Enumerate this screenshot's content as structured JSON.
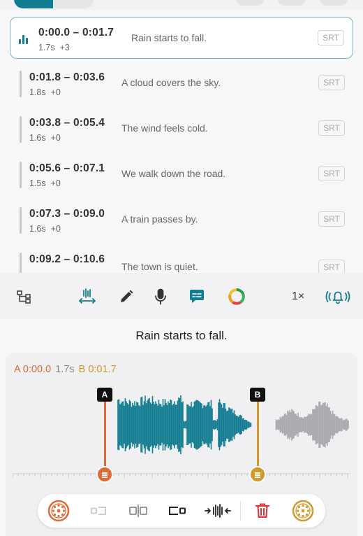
{
  "rows": [
    {
      "time": "0:00.0 – 0:01.7",
      "duration": "1.7s",
      "offset": "+3",
      "text": "Rain starts to fall.",
      "format": "SRT",
      "selected": true
    },
    {
      "time": "0:01.8 – 0:03.6",
      "duration": "1.8s",
      "offset": "+0",
      "text": "A cloud covers the sky.",
      "format": "SRT"
    },
    {
      "time": "0:03.8 – 0:05.4",
      "duration": "1.6s",
      "offset": "+0",
      "text": "The wind feels cold.",
      "format": "SRT"
    },
    {
      "time": "0:05.6 – 0:07.1",
      "duration": "1.5s",
      "offset": "+0",
      "text": "We walk down the road.",
      "format": "SRT"
    },
    {
      "time": "0:07.3 – 0:09.0",
      "duration": "1.6s",
      "offset": "+0",
      "text": "A train passes by.",
      "format": "SRT"
    },
    {
      "time": "0:09.2 – 0:10.6",
      "duration": "",
      "offset": "",
      "text": "The town is quiet.",
      "format": "SRT"
    }
  ],
  "toolbar": {
    "icons": [
      "structure-icon",
      "fit-width-icon",
      "pencil-icon",
      "microphone-icon",
      "subtitle-icon",
      "color-ring-icon",
      "vibrate-bell-icon"
    ],
    "speed": "1×"
  },
  "current_caption": "Rain starts to fall.",
  "editor": {
    "a_label": "A 0:00.0",
    "duration": "1.7s",
    "b_label": "B 0:01.7",
    "marker_a": "A",
    "marker_b": "B"
  },
  "bottom_bar": {
    "icons": [
      "jog-wheel-left-icon",
      "trim-left-icon",
      "split-icon",
      "trim-right-icon",
      "compress-icon",
      "trash-icon",
      "jog-wheel-right-icon"
    ]
  },
  "colors": {
    "accent": "#127d90",
    "marker_a": "#e06a35",
    "marker_b": "#d19a2a",
    "delete": "#e03030"
  }
}
